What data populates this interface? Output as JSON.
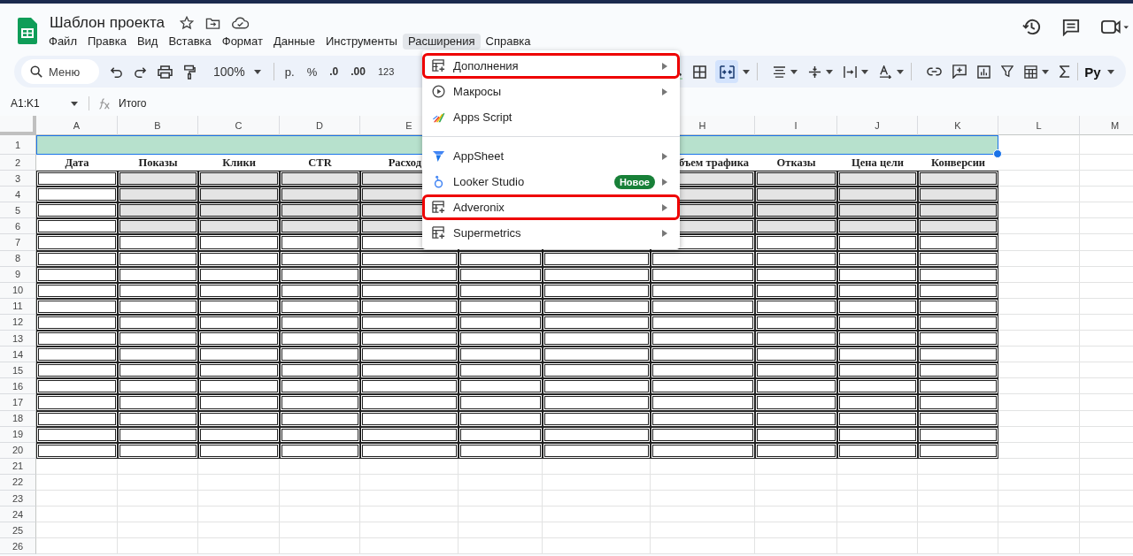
{
  "document": {
    "title": "Шаблон проекта"
  },
  "menu_bar": [
    {
      "label": "Файл",
      "selected": false
    },
    {
      "label": "Правка",
      "selected": false
    },
    {
      "label": "Вид",
      "selected": false
    },
    {
      "label": "Вставка",
      "selected": false
    },
    {
      "label": "Формат",
      "selected": false
    },
    {
      "label": "Данные",
      "selected": false
    },
    {
      "label": "Инструменты",
      "selected": false
    },
    {
      "label": "Расширения",
      "selected": true
    },
    {
      "label": "Справка",
      "selected": false
    }
  ],
  "toolbar": {
    "search_placeholder": "Меню",
    "zoom": "100%",
    "currency": "р.",
    "percent": "%",
    "decrease_decimals": ".0",
    "increase_decimals": ".00",
    "number_format": "123",
    "input_tools": "Ру",
    "merge_active": true
  },
  "formula_bar": {
    "range": "A1:K1",
    "formula": "Итого"
  },
  "sheet": {
    "columns": [
      "A",
      "B",
      "C",
      "D",
      "E",
      "H",
      "I",
      "J",
      "K",
      "L",
      "M"
    ],
    "row_numbers": [
      "1",
      "2",
      "3",
      "4",
      "5",
      "6",
      "7",
      "8",
      "9",
      "10",
      "11",
      "12",
      "13",
      "14",
      "15",
      "16",
      "17",
      "18",
      "19",
      "20",
      "21",
      "22",
      "23",
      "24",
      "25",
      "26"
    ],
    "title_row": {
      "selected": true
    },
    "headers": [
      "Дата",
      "Показы",
      "Клики",
      "CTR",
      "Расход",
      "бъем трафика",
      "Отказы",
      "Цена цели",
      "Конверсии"
    ],
    "body_rows": [
      {
        "shaded": true
      },
      {
        "shaded": true
      },
      {
        "shaded": true
      },
      {
        "shaded": true
      },
      {
        "shaded": false
      },
      {
        "shaded": false
      },
      {
        "shaded": false
      },
      {
        "shaded": false
      },
      {
        "shaded": false
      },
      {
        "shaded": false
      },
      {
        "shaded": false
      },
      {
        "shaded": false
      },
      {
        "shaded": false
      },
      {
        "shaded": false
      },
      {
        "shaded": false
      },
      {
        "shaded": false
      },
      {
        "shaded": false
      },
      {
        "shaded": false
      }
    ]
  },
  "extensions_menu": {
    "items": [
      {
        "kind": "addon",
        "label": "Дополнения",
        "submenu": true,
        "highlighted": true,
        "divider_after": false
      },
      {
        "kind": "macro",
        "label": "Макросы",
        "submenu": true,
        "highlighted": false,
        "divider_after": false
      },
      {
        "kind": "script",
        "label": "Apps Script",
        "submenu": false,
        "highlighted": false,
        "divider_after": true
      },
      {
        "kind": "appsheet",
        "label": "AppSheet",
        "submenu": true,
        "highlighted": false,
        "divider_after": false
      },
      {
        "kind": "looker",
        "label": "Looker Studio",
        "badge": "Новое",
        "submenu": true,
        "highlighted": false,
        "divider_after": false
      },
      {
        "kind": "addon",
        "label": "Adveronix",
        "submenu": true,
        "highlighted": true,
        "divider_after": false
      },
      {
        "kind": "addon",
        "label": "Supermetrics",
        "submenu": true,
        "highlighted": false,
        "divider_after": false
      }
    ]
  }
}
